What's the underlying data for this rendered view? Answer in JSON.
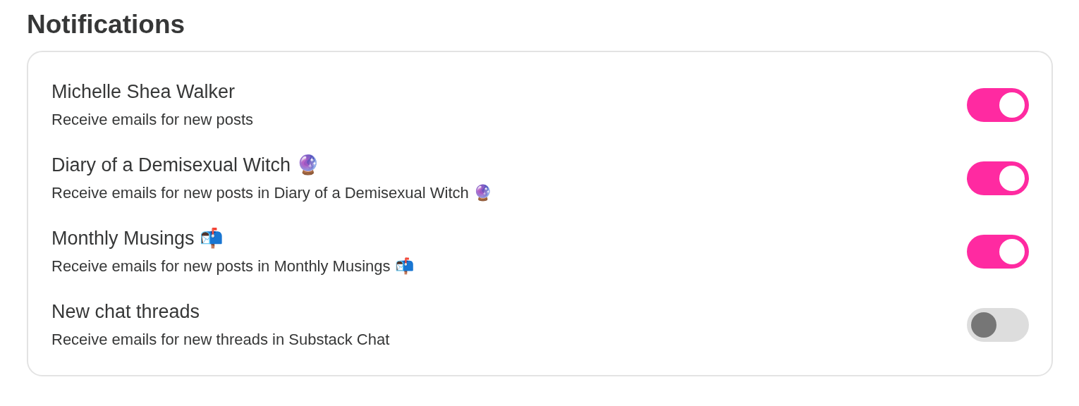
{
  "heading": "Notifications",
  "items": [
    {
      "title": "Michelle Shea Walker",
      "description": "Receive emails for new posts",
      "on": true
    },
    {
      "title": "Diary of a Demisexual Witch 🔮",
      "description": "Receive emails for new posts in Diary of a Demisexual Witch 🔮",
      "on": true
    },
    {
      "title": "Monthly Musings 📬",
      "description": "Receive emails for new posts in Monthly Musings 📬",
      "on": true
    },
    {
      "title": "New chat threads",
      "description": "Receive emails for new threads in Substack Chat",
      "on": false
    }
  ]
}
